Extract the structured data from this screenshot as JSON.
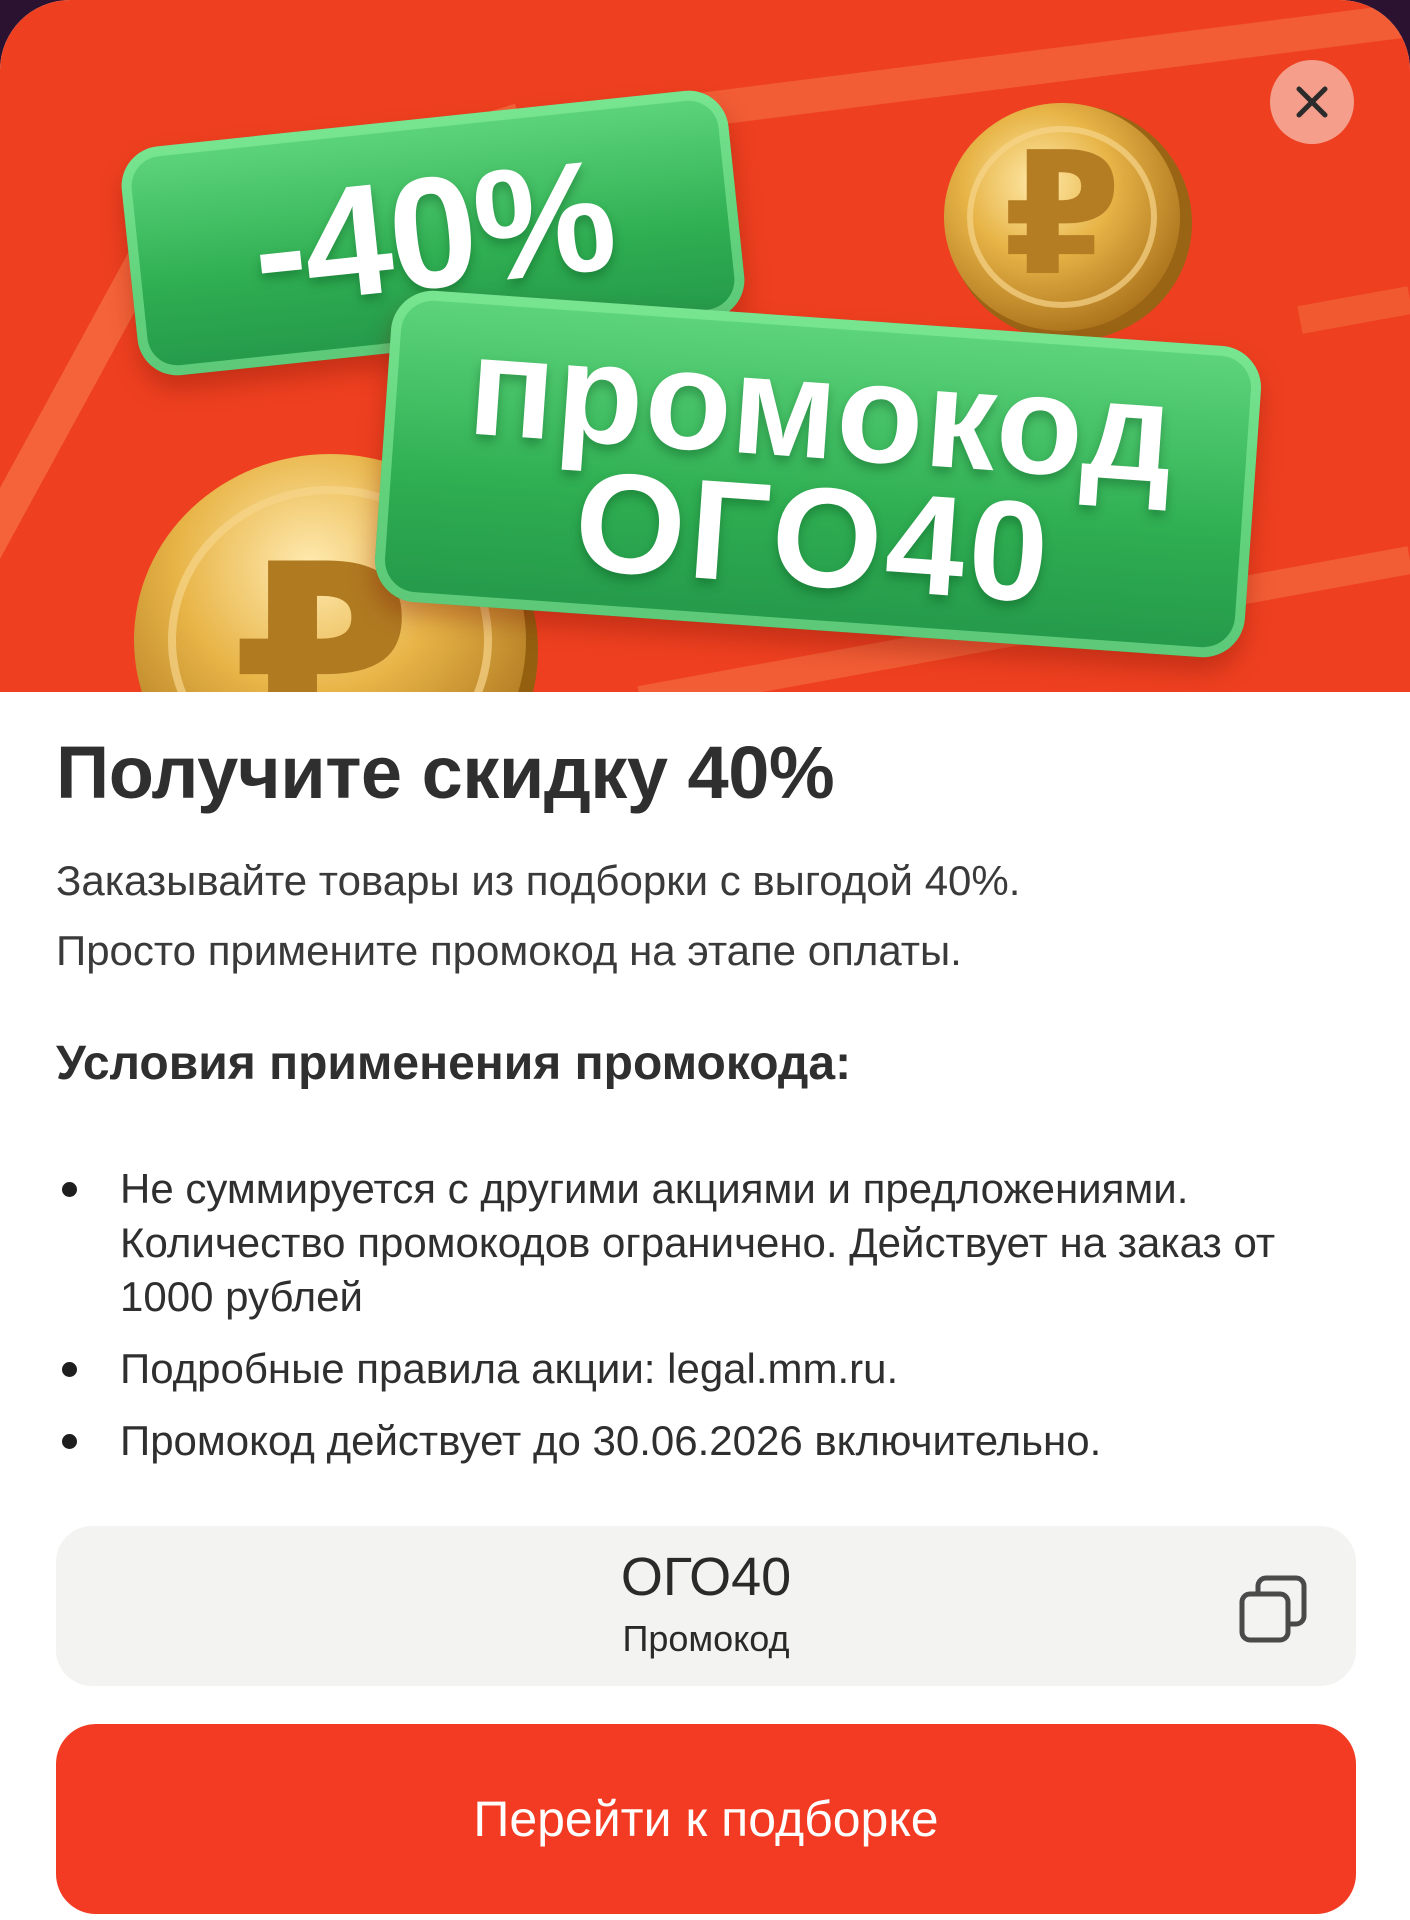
{
  "banner": {
    "badge_discount": "-40%",
    "badge_line1": "промокод",
    "badge_line2": "ОГО40",
    "currency_symbol": "₽",
    "background_color": "#ee4020",
    "badge_color": "#33b356"
  },
  "close_icon": "close-icon",
  "title": "Получите скидку 40%",
  "description": {
    "line1": "Заказывайте товары из подборки с выгодой 40%.",
    "line2": "Просто примените промокод на этапе оплаты."
  },
  "conditions": {
    "title": "Условия применения промокода:",
    "items": [
      "Не суммируется с другими акциями и предложениями. Количество промокодов ограничено. Действует на заказ от 1000 рублей",
      "Подробные правила акции: legal.mm.ru.",
      "Промокод действует до 30.06.2026 включительно."
    ]
  },
  "promo": {
    "code": "ОГО40",
    "label": "Промокод",
    "copy_icon": "copy-icon"
  },
  "cta": {
    "label": "Перейти к подборке",
    "color": "#f23b22"
  }
}
